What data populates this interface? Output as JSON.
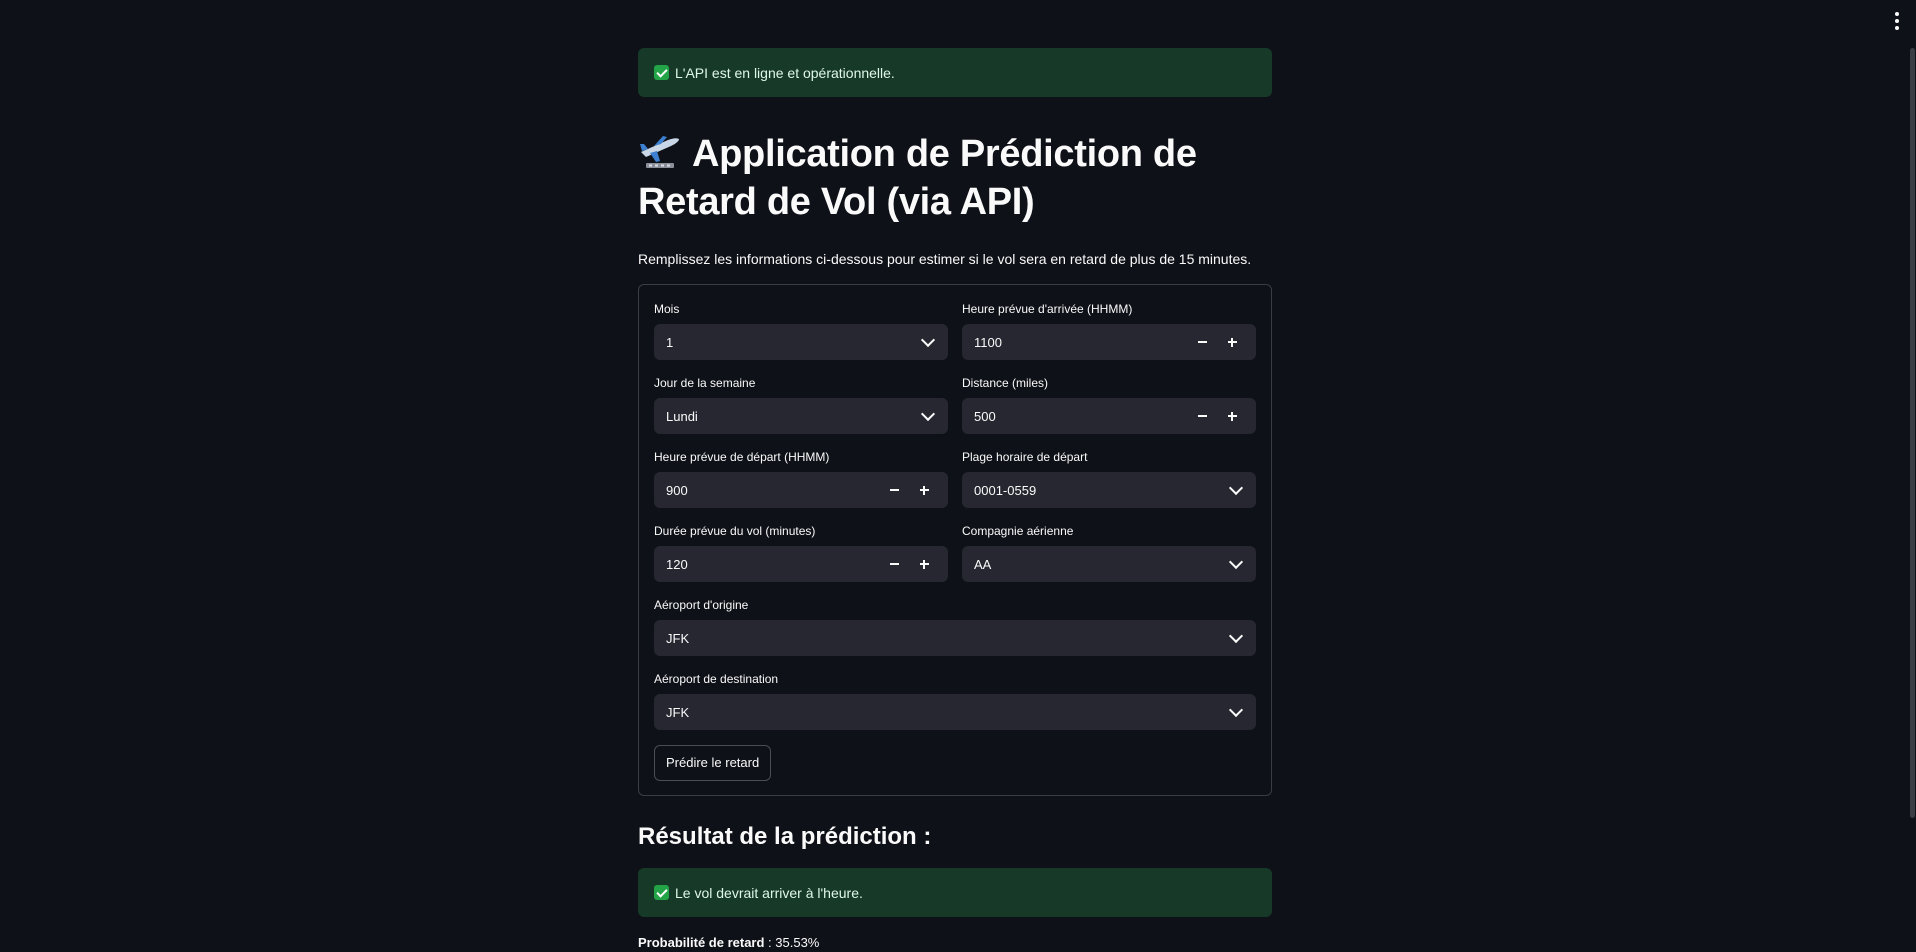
{
  "status_alert": {
    "text": "L'API est en ligne et opérationnelle."
  },
  "header": {
    "title": "Application de Prédiction de Retard de Vol (via API)",
    "subtitle": "Remplissez les informations ci-dessous pour estimer si le vol sera en retard de plus de 15 minutes."
  },
  "form": {
    "month": {
      "label": "Mois",
      "value": "1"
    },
    "arrival_time": {
      "label": "Heure prévue d'arrivée (HHMM)",
      "value": "1100"
    },
    "day_of_week": {
      "label": "Jour de la semaine",
      "value": "Lundi"
    },
    "distance": {
      "label": "Distance (miles)",
      "value": "500"
    },
    "departure_time": {
      "label": "Heure prévue de départ (HHMM)",
      "value": "900"
    },
    "departure_slot": {
      "label": "Plage horaire de départ",
      "value": "0001-0559"
    },
    "duration": {
      "label": "Durée prévue du vol (minutes)",
      "value": "120"
    },
    "airline": {
      "label": "Compagnie aérienne",
      "value": "AA"
    },
    "origin": {
      "label": "Aéroport d'origine",
      "value": "JFK"
    },
    "destination": {
      "label": "Aéroport de destination",
      "value": "JFK"
    },
    "submit_label": "Prédire le retard"
  },
  "result": {
    "heading": "Résultat de la prédiction :",
    "message": "Le vol devrait arriver à l'heure.",
    "probability_label": "Probabilité de retard",
    "probability_value": ": 35.53%"
  },
  "colors": {
    "background": "#0e1117",
    "success_bg": "#173928",
    "input_bg": "#262730"
  }
}
